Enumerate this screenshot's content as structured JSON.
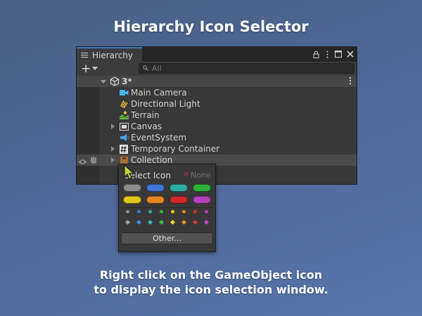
{
  "page": {
    "title": "Hierarchy Icon Selector",
    "caption_line1": "Right click on the GameObject icon",
    "caption_line2": "to display the icon selection window."
  },
  "window": {
    "tab_label": "Hierarchy",
    "search_placeholder": "All",
    "scene_name": "3*"
  },
  "hierarchy": [
    {
      "label": "Main Camera",
      "icon": "camera-icon",
      "expandable": false
    },
    {
      "label": "Directional Light",
      "icon": "light-icon",
      "expandable": false
    },
    {
      "label": "Terrain",
      "icon": "terrain-icon",
      "expandable": false
    },
    {
      "label": "Canvas",
      "icon": "canvas-icon",
      "expandable": true
    },
    {
      "label": "EventSystem",
      "icon": "eventsystem-icon",
      "expandable": false
    },
    {
      "label": "Temporary Container",
      "icon": "hash-icon",
      "expandable": true
    },
    {
      "label": "Collection",
      "icon": "box-icon",
      "expandable": true,
      "selected": true
    }
  ],
  "popup": {
    "title": "Select Icon",
    "none_label": "None",
    "other_label": "Other...",
    "label_colors": [
      "#8e8e8e",
      "#3e78d4",
      "#2fada3",
      "#2eb33a",
      "#e0c71c",
      "#e5851d",
      "#d12a2a",
      "#b53fb9"
    ],
    "dot_colors": [
      "#8e8e8e",
      "#3e78d4",
      "#2fada3",
      "#2eb33a",
      "#e0c71c",
      "#e5851d",
      "#d12a2a",
      "#b53fb9"
    ]
  },
  "colors": {
    "tab_accent": "#3a79bb",
    "window_bg": "#383838"
  }
}
